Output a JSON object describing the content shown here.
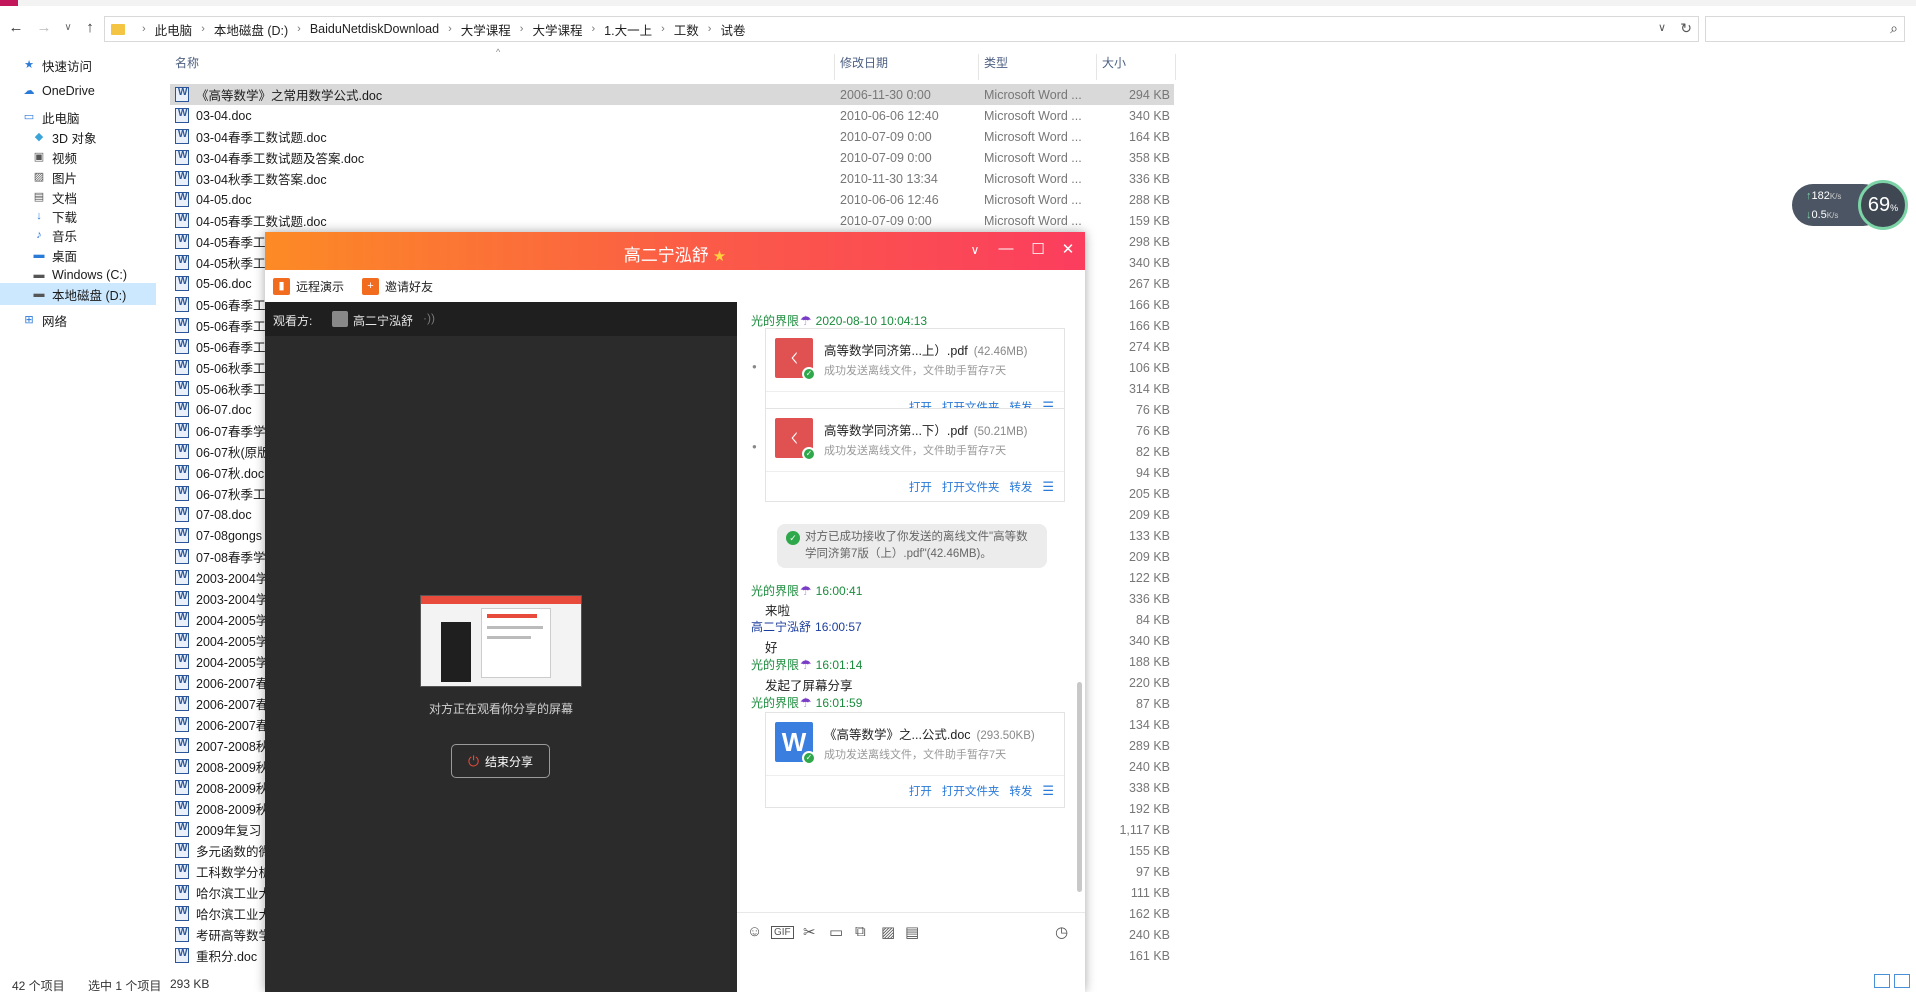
{
  "explorer": {
    "breadcrumb": [
      "此电脑",
      "本地磁盘 (D:)",
      "BaiduNetdiskDownload",
      "大学课程",
      "大学课程",
      "1.大一上",
      "工数",
      "试卷"
    ],
    "columns": {
      "name": "名称",
      "date": "修改日期",
      "type": "类型",
      "size": "大小"
    },
    "sidebar": [
      {
        "label": "快速访问",
        "icon": "star-icon"
      },
      {
        "label": "OneDrive",
        "icon": "cloud-icon"
      },
      {
        "label": "此电脑",
        "icon": "computer-icon"
      },
      {
        "label": "3D 对象",
        "icon": "cube-icon"
      },
      {
        "label": "视频",
        "icon": "video-icon"
      },
      {
        "label": "图片",
        "icon": "picture-icon"
      },
      {
        "label": "文档",
        "icon": "document-icon"
      },
      {
        "label": "下载",
        "icon": "download-icon"
      },
      {
        "label": "音乐",
        "icon": "music-icon"
      },
      {
        "label": "桌面",
        "icon": "desktop-icon"
      },
      {
        "label": "Windows (C:)",
        "icon": "drive-icon"
      },
      {
        "label": "本地磁盘 (D:)",
        "icon": "drive-icon"
      },
      {
        "label": "网络",
        "icon": "network-icon"
      }
    ],
    "files": [
      {
        "name": "《高等数学》之常用数学公式.doc",
        "date": "2006-11-30  0:00",
        "type": "Microsoft Word ...",
        "size": "294 KB"
      },
      {
        "name": "03-04.doc",
        "date": "2010-06-06  12:40",
        "type": "Microsoft Word ...",
        "size": "340 KB"
      },
      {
        "name": "03-04春季工数试题.doc",
        "date": "2010-07-09  0:00",
        "type": "Microsoft Word ...",
        "size": "164 KB"
      },
      {
        "name": "03-04春季工数试题及答案.doc",
        "date": "2010-07-09  0:00",
        "type": "Microsoft Word ...",
        "size": "358 KB"
      },
      {
        "name": "03-04秋季工数答案.doc",
        "date": "2010-11-30  13:34",
        "type": "Microsoft Word ...",
        "size": "336 KB"
      },
      {
        "name": "04-05.doc",
        "date": "2010-06-06  12:46",
        "type": "Microsoft Word ...",
        "size": "288 KB"
      },
      {
        "name": "04-05春季工数试题.doc",
        "date": "2010-07-09  0:00",
        "type": "Microsoft Word ...",
        "size": "159 KB"
      },
      {
        "name": "04-05春季工",
        "date": "",
        "type": "",
        "size": "298 KB"
      },
      {
        "name": "04-05秋季工",
        "date": "",
        "type": "",
        "size": "340 KB"
      },
      {
        "name": "05-06.doc",
        "date": "",
        "type": "",
        "size": "267 KB"
      },
      {
        "name": "05-06春季工数",
        "date": "",
        "type": "",
        "size": "166 KB"
      },
      {
        "name": "05-06春季工",
        "date": "",
        "type": "",
        "size": "166 KB"
      },
      {
        "name": "05-06春季工",
        "date": "",
        "type": "",
        "size": "274 KB"
      },
      {
        "name": "05-06秋季工",
        "date": "",
        "type": "",
        "size": "106 KB"
      },
      {
        "name": "05-06秋季工",
        "date": "",
        "type": "",
        "size": "314 KB"
      },
      {
        "name": "06-07.doc",
        "date": "",
        "type": "",
        "size": "76 KB"
      },
      {
        "name": "06-07春季学",
        "date": "",
        "type": "",
        "size": "76 KB"
      },
      {
        "name": "06-07秋(原版",
        "date": "",
        "type": "",
        "size": "82 KB"
      },
      {
        "name": "06-07秋.doc",
        "date": "",
        "type": "",
        "size": "94 KB"
      },
      {
        "name": "06-07秋季工",
        "date": "",
        "type": "",
        "size": "205 KB"
      },
      {
        "name": "07-08.doc",
        "date": "",
        "type": "",
        "size": "209 KB"
      },
      {
        "name": "07-08gongs",
        "date": "",
        "type": "",
        "size": "133 KB"
      },
      {
        "name": "07-08春季学",
        "date": "",
        "type": "",
        "size": "209 KB"
      },
      {
        "name": "2003-2004学",
        "date": "",
        "type": "",
        "size": "122 KB"
      },
      {
        "name": "2003-2004学",
        "date": "",
        "type": "",
        "size": "336 KB"
      },
      {
        "name": "2004-2005学",
        "date": "",
        "type": "",
        "size": "84 KB"
      },
      {
        "name": "2004-2005学",
        "date": "",
        "type": "",
        "size": "340 KB"
      },
      {
        "name": "2004-2005学",
        "date": "",
        "type": "",
        "size": "188 KB"
      },
      {
        "name": "2006-2007春",
        "date": "",
        "type": "",
        "size": "220 KB"
      },
      {
        "name": "2006-2007春",
        "date": "",
        "type": "",
        "size": "87 KB"
      },
      {
        "name": "2006-2007春",
        "date": "",
        "type": "",
        "size": "134 KB"
      },
      {
        "name": "2007-2008秋",
        "date": "",
        "type": "",
        "size": "289 KB"
      },
      {
        "name": "2008-2009秋",
        "date": "",
        "type": "",
        "size": "240 KB"
      },
      {
        "name": "2008-2009秋",
        "date": "",
        "type": "",
        "size": "338 KB"
      },
      {
        "name": "2008-2009秋",
        "date": "",
        "type": "",
        "size": "192 KB"
      },
      {
        "name": "2009年复习",
        "date": "",
        "type": "",
        "size": "1,117 KB"
      },
      {
        "name": "多元函数的微",
        "date": "",
        "type": "",
        "size": "155 KB"
      },
      {
        "name": "工科数学分析",
        "date": "",
        "type": "",
        "size": "97 KB"
      },
      {
        "name": "哈尔滨工业大",
        "date": "",
        "type": "",
        "size": "111 KB"
      },
      {
        "name": "哈尔滨工业大",
        "date": "",
        "type": "",
        "size": "162 KB"
      },
      {
        "name": "考研高等数学",
        "date": "",
        "type": "",
        "size": "240 KB"
      },
      {
        "name": "重积分.doc",
        "date": "",
        "type": "",
        "size": "161 KB"
      }
    ],
    "status": {
      "count": "42 个项目",
      "selected": "选中 1 个项目",
      "size": "293 KB"
    }
  },
  "speed": {
    "up": "182",
    "up_unit": "K/s",
    "down": "0.5",
    "down_unit": "K/s",
    "percent": "69",
    "percent_unit": "%"
  },
  "chat": {
    "title": "高二宁泓舒",
    "tools": [
      "远程演示",
      "邀请好友"
    ],
    "viewer_label": "观看方:",
    "viewer_name": "高二宁泓舒",
    "sharing_text": "对方正在观看你分享的屏幕",
    "end_share": "结束分享",
    "messages": {
      "m1_sender": "光的界限",
      "m1_time": "2020-08-10  10:04:13",
      "file1_name": "高等数学同济第...上）.pdf",
      "file1_size": "(42.46MB)",
      "file2_name": "高等数学同济第...下）.pdf",
      "file2_size": "(50.21MB)",
      "file_status": "成功发送离线文件，文件助手暂存7天",
      "action_open": "打开",
      "action_folder": "打开文件夹",
      "action_forward": "转发",
      "sys_note": "对方已成功接收了你发送的离线文件\"高等数学同济第7版（上）.pdf\"(42.46MB)。",
      "m2_sender": "光的界限",
      "m2_time": "16:00:41",
      "m2_text": "来啦",
      "m3_sender": "高二宁泓舒",
      "m3_time": "16:00:57",
      "m3_text": "好",
      "m4_sender": "光的界限",
      "m4_time": "16:01:14",
      "m4_text": "发起了屏幕分享",
      "m5_sender": "光的界限",
      "m5_time": "16:01:59",
      "file3_name": "《高等数学》之...公式.doc",
      "file3_size": "(293.50KB)"
    }
  }
}
